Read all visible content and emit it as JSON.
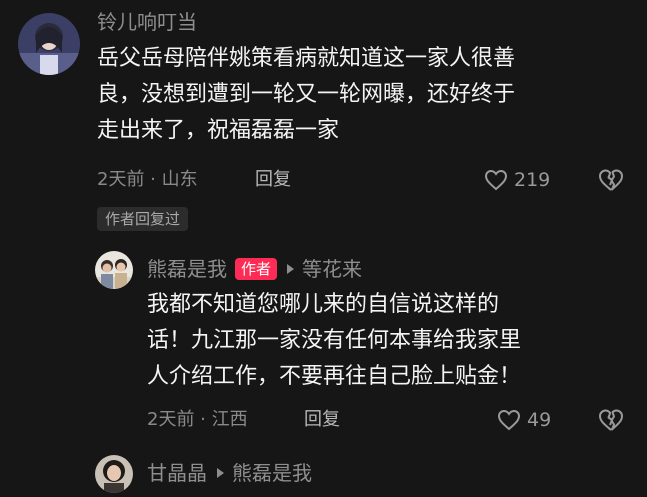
{
  "colors": {
    "background": "#161616",
    "author_badge": "#fe2c55",
    "meta_text": "#8a8a8a"
  },
  "comments": [
    {
      "username": "铃儿响叮当",
      "avatar": "avatar-anime-girl",
      "lines": [
        "岳父岳母陪伴姚策看病就知道这一家人很善",
        "良，没想到遭到一轮又一轮网曝，还好终于",
        "走出来了，祝福磊磊一家"
      ],
      "meta": "2天前 · 山东",
      "reply_label": "回复",
      "likes": "219",
      "author_replied": "作者回复过"
    }
  ],
  "replies": [
    {
      "username": "熊磊是我",
      "avatar": "avatar-family-photo",
      "badge": "作者",
      "reply_to": "等花来",
      "lines": [
        "我都不知道您哪儿来的自信说这样的",
        "话！九江那一家没有任何本事给我家里",
        "人介绍工作，不要再往自己脸上贴金！"
      ],
      "meta": "2天前 · 江西",
      "reply_label": "回复",
      "likes": "49"
    },
    {
      "username": "甘晶晶",
      "avatar": "avatar-woman-photo",
      "reply_to": "熊磊是我"
    }
  ]
}
